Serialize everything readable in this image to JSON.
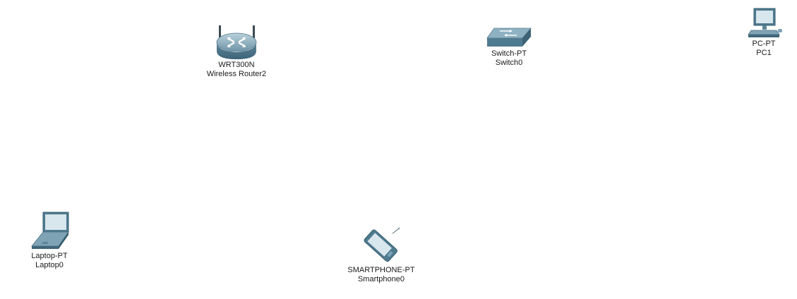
{
  "workspace": {
    "devices": [
      {
        "id": "router",
        "model": "WRT300N",
        "name": "Wireless Router2",
        "icon": "wireless-router-icon"
      },
      {
        "id": "switch",
        "model": "Switch-PT",
        "name": "Switch0",
        "icon": "switch-icon"
      },
      {
        "id": "pc",
        "model": "PC-PT",
        "name": "PC1",
        "icon": "pc-icon"
      },
      {
        "id": "laptop",
        "model": "Laptop-PT",
        "name": "Laptop0",
        "icon": "laptop-icon"
      },
      {
        "id": "phone",
        "model": "SMARTPHONE-PT",
        "name": "Smartphone0",
        "icon": "smartphone-icon"
      }
    ]
  }
}
